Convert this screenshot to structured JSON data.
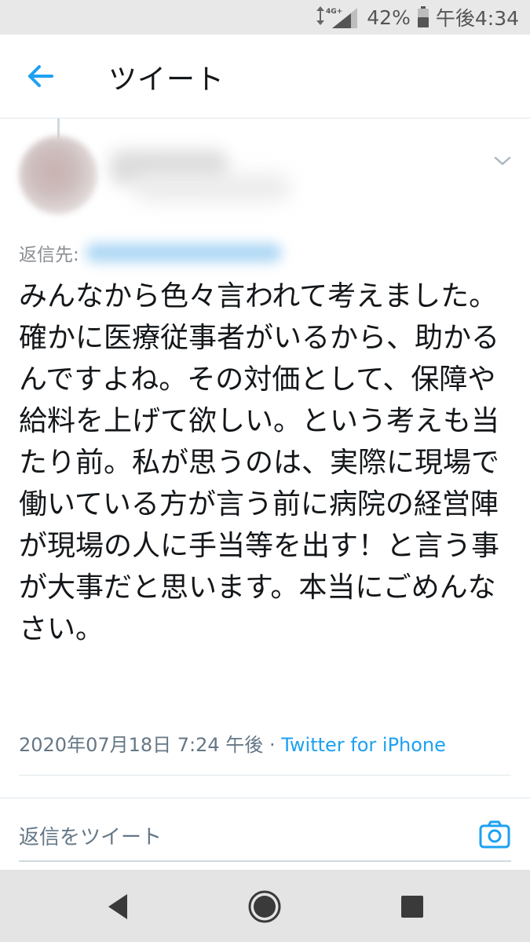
{
  "status_bar": {
    "network": "4G+",
    "battery": "42%",
    "time": "午後4:34"
  },
  "header": {
    "title": "ツイート",
    "back_icon": "arrow-left-icon"
  },
  "tweet": {
    "reply_to_label": "返信先:",
    "text": "みんなから色々言われて考えました。\n確かに医療従事者がいるから、助かるんですよね。その対価として、保障や給料を上げて欲しい。という考えも当たり前。私が思うのは、実際に現場で働いている方が言う前に病院の経営陣が現場の人に手当等を出す！と言う事が大事だと思います。本当にごめんなさい。",
    "timestamp": "2020年07月18日 7:24 午後",
    "separator": " · ",
    "source": "Twitter for iPhone"
  },
  "reply": {
    "placeholder": "返信をツイート",
    "camera_icon": "camera-icon"
  },
  "nav": {
    "back_icon": "nav-back-icon",
    "home_icon": "nav-home-icon",
    "recents_icon": "nav-recents-icon"
  },
  "colors": {
    "accent": "#1da1f2",
    "text": "#14171a",
    "secondary": "#657786",
    "status_bg": "#e8e8e8",
    "nav_bg": "#e4e4e4"
  }
}
